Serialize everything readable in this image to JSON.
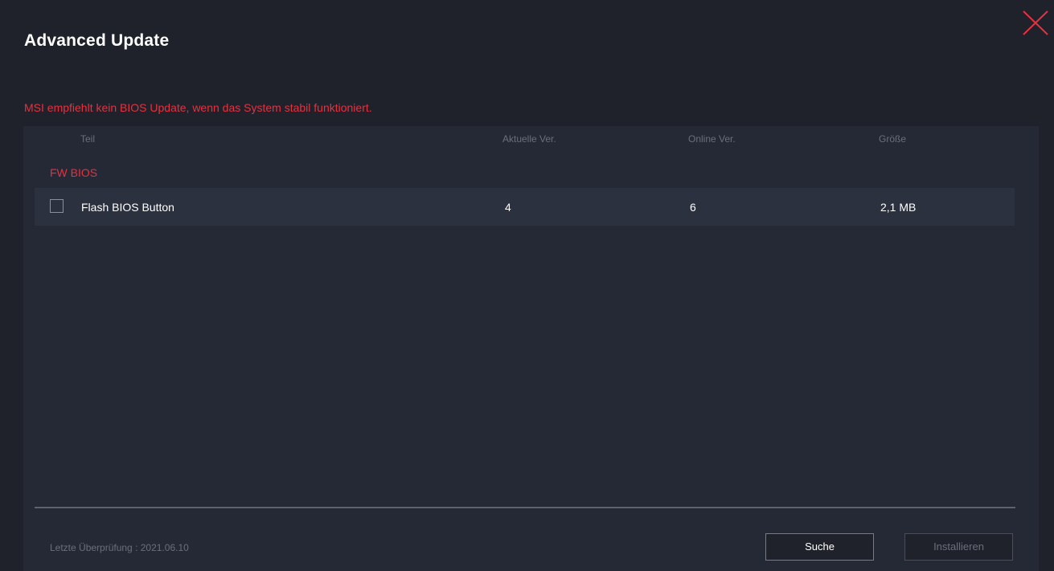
{
  "window": {
    "title": "Advanced Update",
    "close_icon": "close-icon"
  },
  "warning": "MSI empfiehlt kein BIOS Update, wenn das System stabil funktioniert.",
  "table": {
    "columns": [
      "Teil",
      "Aktuelle Ver.",
      "Online Ver.",
      "Größe"
    ],
    "groups": [
      {
        "label": "FW BIOS",
        "rows": [
          {
            "checked": false,
            "name": "Flash BIOS Button",
            "current_version": "4",
            "online_version": "6",
            "size": "2,1 MB"
          }
        ]
      }
    ]
  },
  "footer": {
    "last_check": "Letzte Überprüfung : 2021.06.10",
    "search_label": "Suche",
    "install_label": "Installieren",
    "install_enabled": false
  },
  "colors": {
    "background": "#1f222a",
    "panel": "#252935",
    "row_highlight": "#2c3140",
    "accent_red": "#e8303f",
    "muted_text": "#6a6f7b"
  }
}
